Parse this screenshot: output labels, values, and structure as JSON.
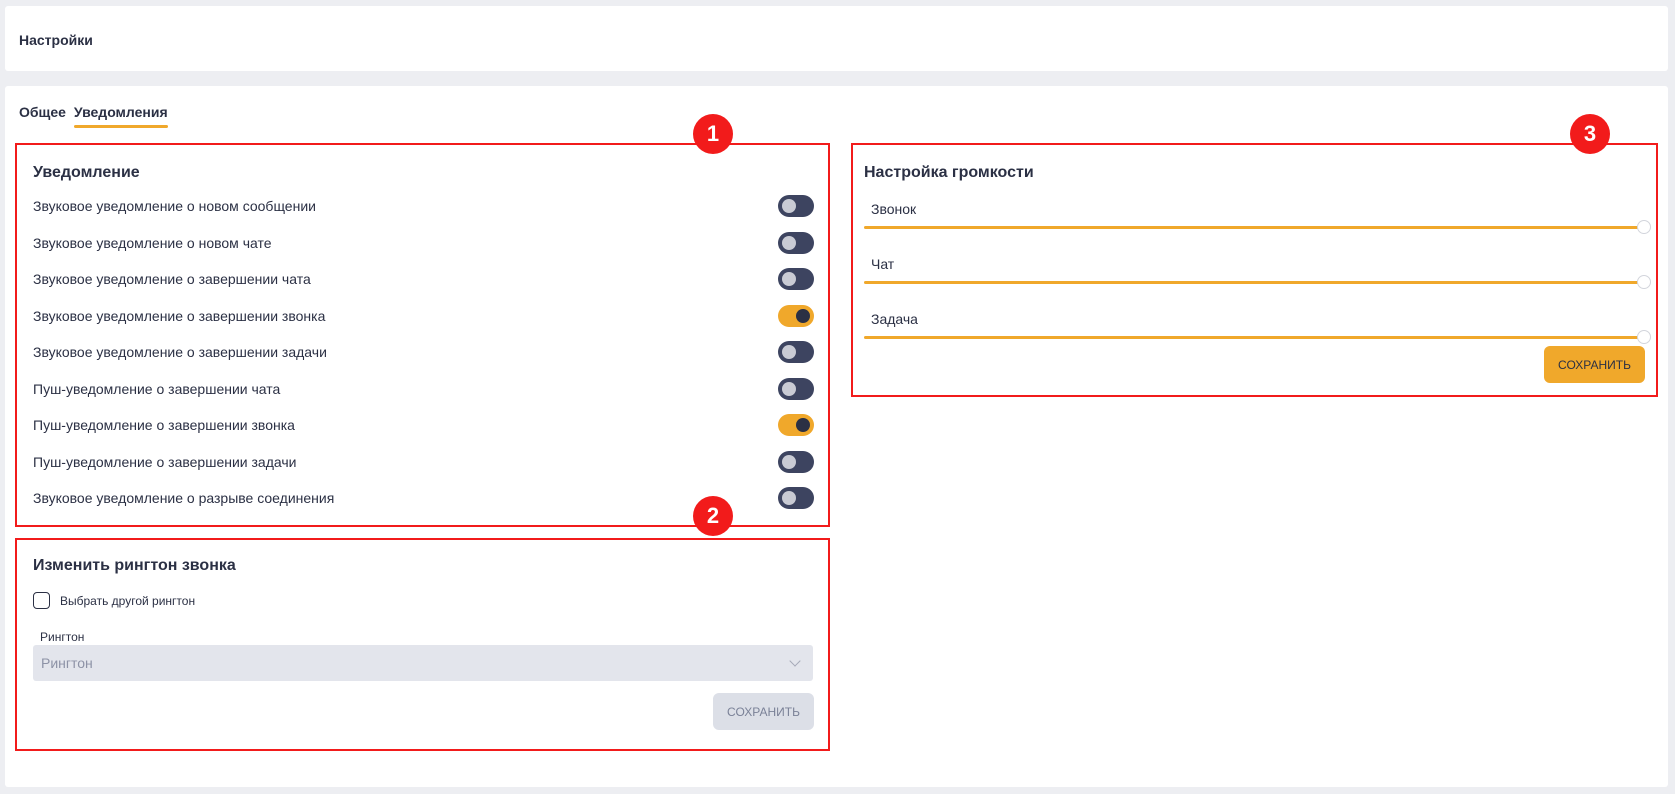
{
  "header": {
    "title": "Настройки"
  },
  "tabs": [
    {
      "label": "Общее",
      "active": false
    },
    {
      "label": "Уведомления",
      "active": true
    }
  ],
  "notifications": {
    "badge": "1",
    "title": "Уведомление",
    "items": [
      {
        "label": "Звуковое уведомление о новом сообщении",
        "on": false
      },
      {
        "label": "Звуковое уведомление о новом чате",
        "on": false
      },
      {
        "label": "Звуковое уведомление о завершении чата",
        "on": false
      },
      {
        "label": "Звуковое уведомление о завершении звонка",
        "on": true
      },
      {
        "label": "Звуковое уведомление о завершении задачи",
        "on": false
      },
      {
        "label": "Пуш-уведомление о завершении чата",
        "on": false
      },
      {
        "label": "Пуш-уведомление о завершении звонка",
        "on": true
      },
      {
        "label": "Пуш-уведомление о завершении задачи",
        "on": false
      },
      {
        "label": "Звуковое уведомление о разрыве соединения",
        "on": false
      }
    ]
  },
  "ringtone": {
    "badge": "2",
    "title": "Изменить рингтон звонка",
    "checkbox_label": "Выбрать другой рингтон",
    "checked": false,
    "select_label": "Рингтон",
    "select_value": "Рингтон",
    "save_label": "СОХРАНИТЬ"
  },
  "volume": {
    "badge": "3",
    "title": "Настройка громкости",
    "sliders": [
      {
        "label": "Звонок",
        "value": 1.0
      },
      {
        "label": "Чат",
        "value": 1.0
      },
      {
        "label": "Задача",
        "value": 1.0
      }
    ],
    "save_label": "СОХРАНИТЬ"
  },
  "colors": {
    "accent": "#f0a82b",
    "toggle_off": "#3d4460",
    "highlight": "#f21b1b"
  }
}
